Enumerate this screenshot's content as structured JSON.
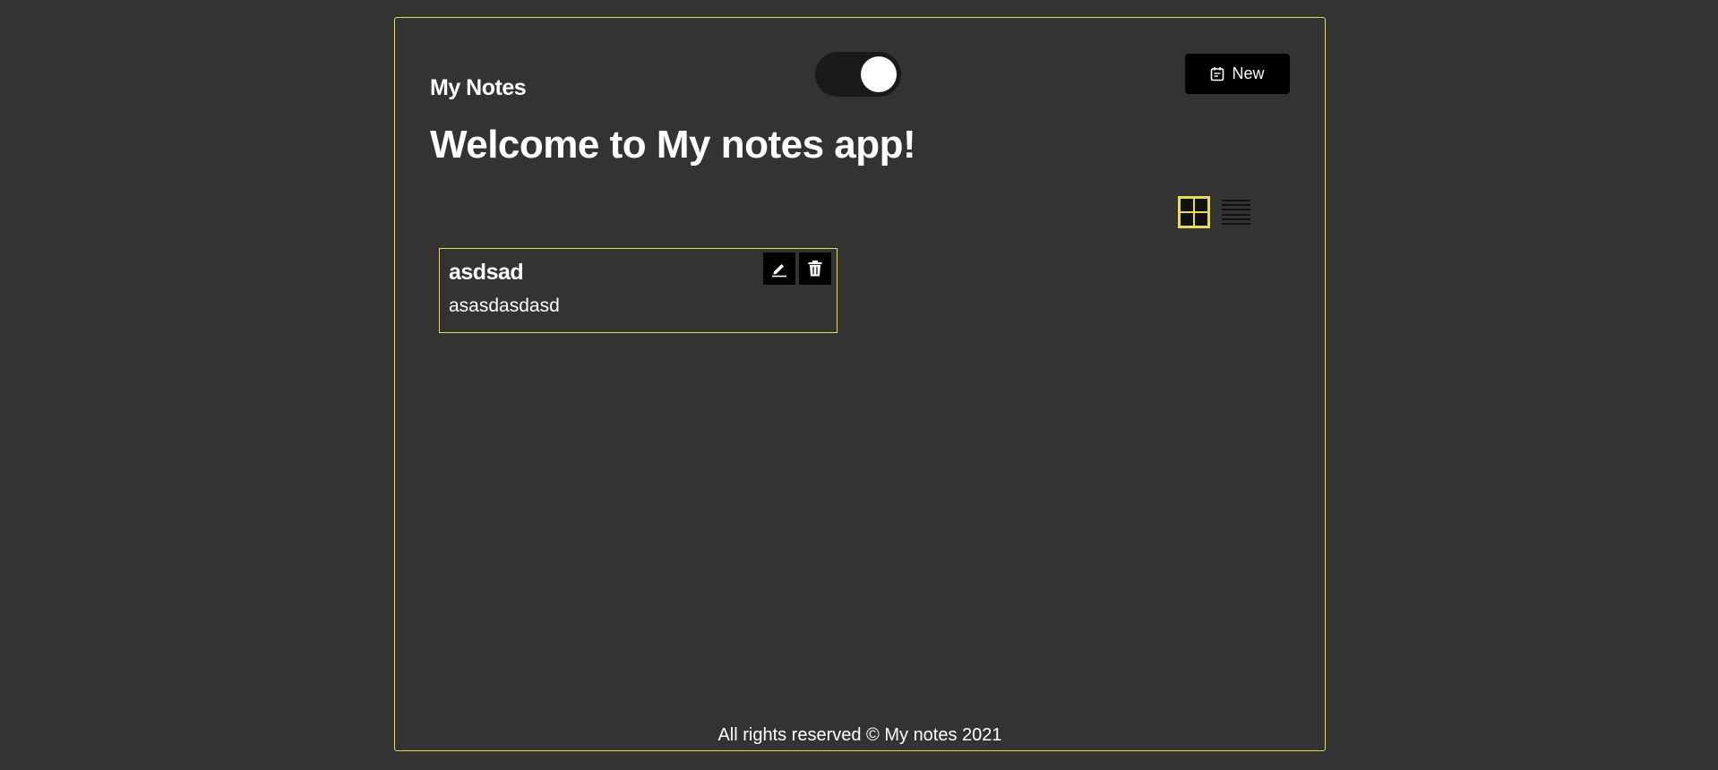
{
  "header": {
    "brand": "My Notes",
    "theme_toggle_on": true,
    "new_button_label": "New"
  },
  "main": {
    "headline": "Welcome to My notes app!",
    "view_modes": [
      "grid-icon",
      "list-icon"
    ],
    "active_view": "grid"
  },
  "notes": [
    {
      "title": "asdsad",
      "body": "asasdasdasd"
    }
  ],
  "footer": {
    "text": "All rights reserved © My notes 2021"
  },
  "colors": {
    "background": "#333333",
    "accent": "#e8dc4f",
    "button": "#000000",
    "text": "#ffffff"
  },
  "icons": {
    "new_button": "calendar-note-icon",
    "edit": "pencil-icon",
    "delete": "trash-icon"
  }
}
